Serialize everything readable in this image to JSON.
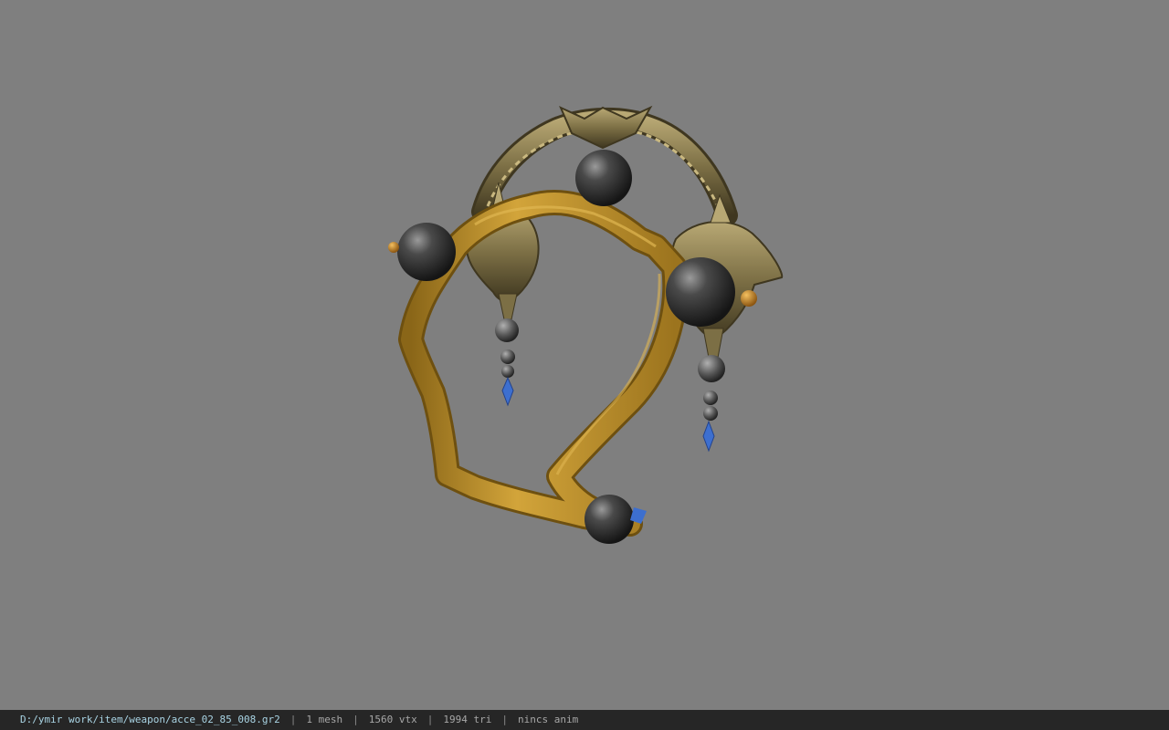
{
  "viewer": {
    "background_color": "#7f7f7f",
    "model": {
      "object-name": "headpiece ornament",
      "colors": {
        "ribbon": "#c3962e",
        "ribbon_shadow": "#8a6618",
        "metal": "#8e8155",
        "metal_dark": "#4d4428",
        "orb": "#3a3a3a",
        "orb_highlight": "#8c8c8c",
        "bead": "#6a6a6a",
        "crystal": "#3d6fcf",
        "gold_bead": "#d08a2a"
      }
    }
  },
  "statusbar": {
    "file_path": "D:/ymir work/item/weapon/acce_02_85_008.gr2",
    "separator": "|",
    "mesh": "1 mesh",
    "vertices": "1560 vtx",
    "triangles": "1994 tri",
    "anim": "nincs anim",
    "background_color": "#262626"
  }
}
